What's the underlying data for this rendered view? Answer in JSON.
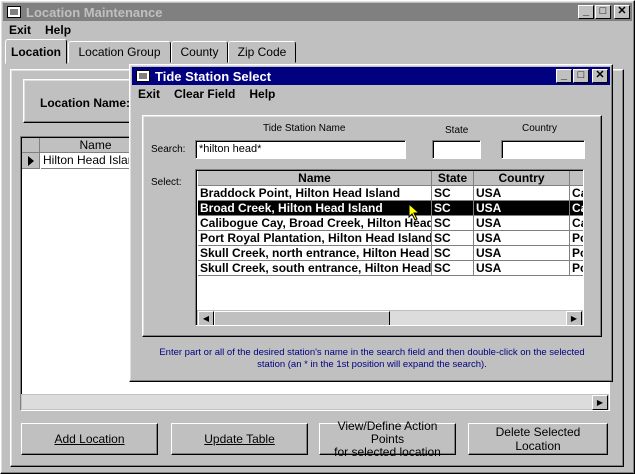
{
  "main_window": {
    "title": "Location Maintenance",
    "menu": [
      "Exit",
      "Help"
    ],
    "tabs": [
      "Location",
      "Location Group",
      "County",
      "Zip Code"
    ],
    "location_name_label": "Location Name:",
    "grid": {
      "header": "Name",
      "rows": [
        "Hilton Head Island"
      ]
    },
    "buttons": {
      "add": "Add Location",
      "update": "Update Table",
      "view_define_line1": "View/Define Action Points",
      "view_define_line2": "for selected location",
      "delete": "Delete Selected Location"
    }
  },
  "dialog": {
    "title": "Tide Station Select",
    "menu": [
      "Exit",
      "Clear Field",
      "Help"
    ],
    "column_labels": {
      "name": "Tide Station Name",
      "state": "State",
      "country": "Country"
    },
    "search_label": "Search:",
    "search_value": "*hilton head*",
    "select_label": "Select:",
    "grid": {
      "headers": [
        "Name",
        "State",
        "Country",
        ""
      ],
      "rows": [
        {
          "name": "Braddock Point, Hilton Head Island",
          "state": "SC",
          "country": "USA",
          "extra": "Ca"
        },
        {
          "name": "Broad Creek, Hilton Head Island",
          "state": "SC",
          "country": "USA",
          "extra": "Ca"
        },
        {
          "name": "Calibogue Cay, Broad Creek, Hilton Head",
          "state": "SC",
          "country": "USA",
          "extra": "Ca"
        },
        {
          "name": "Port Royal Plantation, Hilton Head Island",
          "state": "SC",
          "country": "USA",
          "extra": "Po"
        },
        {
          "name": "Skull Creek, north entrance, Hilton Head",
          "state": "SC",
          "country": "USA",
          "extra": "Po"
        },
        {
          "name": "Skull Creek, south entrance, Hilton Head",
          "state": "SC",
          "country": "USA",
          "extra": "Po"
        }
      ],
      "selected_index": 1
    },
    "hint_line1": "Enter part or all of the desired station's name in the search field and then double-click on the selected",
    "hint_line2": "station (an * in the 1st position will expand the search)."
  },
  "icons": [
    "window-icon",
    "minimize-icon",
    "maximize-icon",
    "close-icon",
    "row-pointer-icon",
    "scroll-left-icon",
    "scroll-right-icon",
    "mouse-cursor-icon"
  ]
}
